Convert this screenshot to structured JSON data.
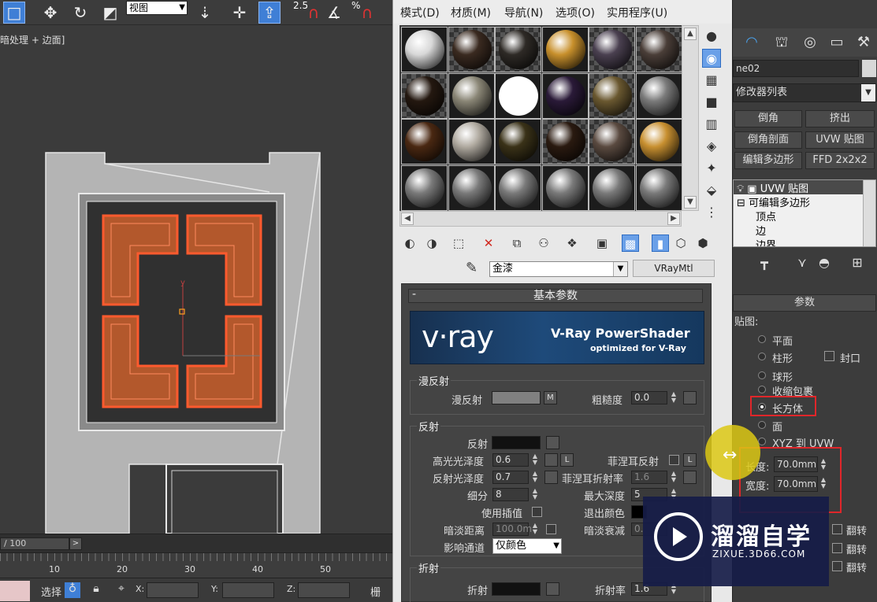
{
  "toolbar": {
    "view_select": "视图",
    "snap_angle": "2.5",
    "percent": "%"
  },
  "viewport": {
    "label": "暗处理 + 边面]"
  },
  "timeline": {
    "frame_counter": "/ 100",
    "next_label": ">",
    "ticks": [
      "10",
      "20",
      "30",
      "40",
      "50"
    ]
  },
  "status": {
    "select_label": "选择",
    "x_label": "X:",
    "y_label": "Y:",
    "z_label": "Z:",
    "grid_label": "栅"
  },
  "material_editor": {
    "menu": [
      "模式(D)",
      "材质(M)",
      "导航(N)",
      "选项(O)",
      "实用程序(U)"
    ],
    "slots": [
      {
        "color": "#d8d8d8",
        "checker": false
      },
      {
        "color": "#3a2a20",
        "checker": true
      },
      {
        "color": "#2e2a26",
        "checker": true
      },
      {
        "color": "#c8902c",
        "checker": false
      },
      {
        "color": "#4a4050",
        "checker": true
      },
      {
        "color": "#4a3e38",
        "checker": true
      },
      {
        "color": "#241810",
        "checker": true
      },
      {
        "color": "#8a8676",
        "checker": false
      },
      {
        "color": "#ffffff",
        "checker": false
      },
      {
        "color": "#2a1a38",
        "checker": false
      },
      {
        "color": "#6a5830",
        "checker": true
      },
      {
        "color": "#7a7a7a",
        "checker": false
      },
      {
        "color": "#4a2812",
        "checker": false
      },
      {
        "color": "#b0aaa0",
        "checker": false
      },
      {
        "color": "#3a3218",
        "checker": false
      },
      {
        "color": "#2a1a10",
        "checker": true
      },
      {
        "color": "#5a4a40",
        "checker": true
      },
      {
        "color": "#c89030",
        "checker": false
      },
      {
        "color": "#7a7a7a",
        "checker": false
      },
      {
        "color": "#7a7a7a",
        "checker": false
      },
      {
        "color": "#7a7a7a",
        "checker": false
      },
      {
        "color": "#7a7a7a",
        "checker": false
      },
      {
        "color": "#7a7a7a",
        "checker": false
      },
      {
        "color": "#7a7a7a",
        "checker": false
      }
    ],
    "material_name": "金漆",
    "material_type": "VRayMtl",
    "rollout_title": "基本参数",
    "banner": {
      "logo": "v·ray",
      "title": "V-Ray PowerShader",
      "subtitle": "optimized for V-Ray"
    },
    "diffuse": {
      "group": "漫反射",
      "diffuse_label": "漫反射",
      "m_label": "M",
      "roughness_label": "粗糙度",
      "roughness_value": "0.0"
    },
    "reflection": {
      "group": "反射",
      "reflect_label": "反射",
      "hilight_gloss_label": "高光光泽度",
      "hilight_gloss_value": "0.6",
      "l_label": "L",
      "fresnel_label": "菲涅耳反射",
      "refl_gloss_label": "反射光泽度",
      "refl_gloss_value": "0.7",
      "fresnel_ior_label": "菲涅耳折射率",
      "fresnel_ior_value": "1.6",
      "subdivs_label": "细分",
      "subdivs_value": "8",
      "max_depth_label": "最大深度",
      "max_depth_value": "5",
      "use_interp_label": "使用插值",
      "exit_color_label": "退出颜色",
      "dim_dist_label": "暗淡距离",
      "dim_dist_value": "100.0m",
      "dim_falloff_label": "暗淡衰减",
      "dim_falloff_value": "0.",
      "affect_channels_label": "影响通道",
      "affect_channels_value": "仅颜色"
    },
    "refraction": {
      "group": "折射",
      "refract_label": "折射",
      "ior_label": "折射率",
      "ior_value": "1.6"
    }
  },
  "command_panel": {
    "object_name": "ne02",
    "modifier_list": "修改器列表",
    "buttons": [
      "倒角",
      "挤出",
      "倒角剖面",
      "UVW 贴图",
      "编辑多边形",
      "FFD 2x2x2"
    ],
    "stack": [
      "UVW 贴图",
      "可编辑多边形",
      "顶点",
      "边",
      "边界"
    ],
    "params_rollout": "参数",
    "mapping_label": "贴图:",
    "mapping_options": [
      "平面",
      "柱形",
      "球形",
      "收缩包裹",
      "长方体",
      "面",
      "XYZ 到 UVW"
    ],
    "cap_label": "封口",
    "length_label": "长度:",
    "length_value": "70.0mm",
    "width_label": "宽度:",
    "width_value": "70.0mm",
    "flip_label": "翻转"
  },
  "watermark": {
    "cn": "溜溜自学",
    "url": "ZIXUE.3D66.COM"
  }
}
